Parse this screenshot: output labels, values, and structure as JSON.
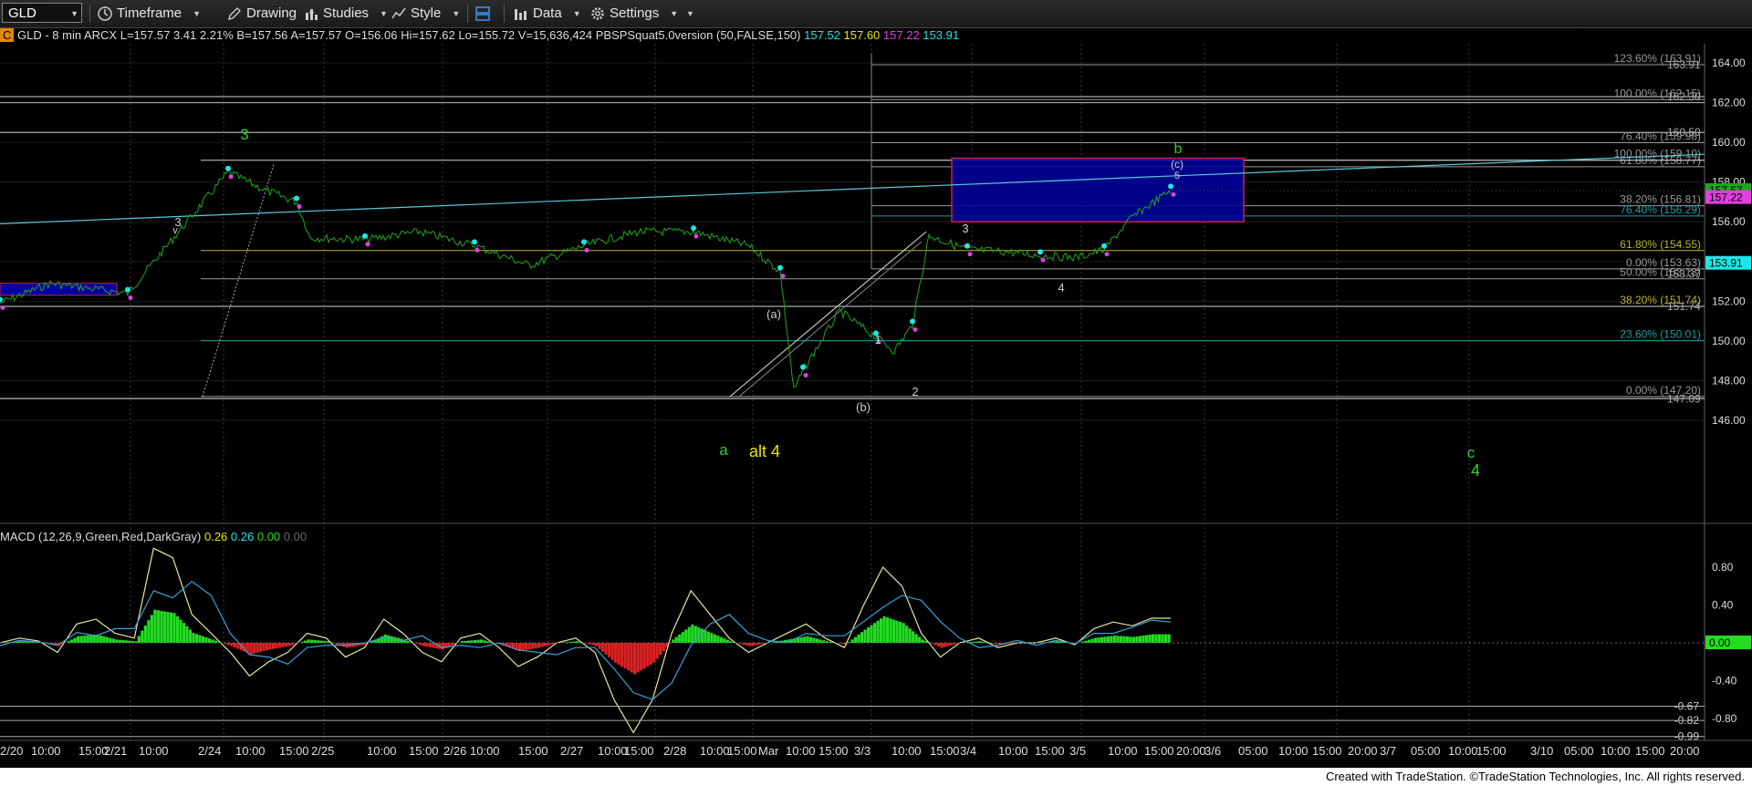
{
  "toolbar": {
    "symbol": "GLD",
    "timeframe": "Timeframe",
    "drawing": "Drawing",
    "studies": "Studies",
    "style": "Style",
    "data": "Data",
    "settings": "Settings"
  },
  "infobar": {
    "badge": "C",
    "symbol": "GLD - 8 min  ARCX",
    "last": "L=157.57",
    "change": "3.41",
    "pct": "2.21%",
    "bid": "B=157.56",
    "ask": "A=157.57",
    "open": "O=156.06",
    "high": "Hi=157.62",
    "low": "Lo=155.72",
    "volume": "V=15,636,424",
    "indicator": "PBSPSquat5.0version (50,FALSE,150)",
    "ind_v1": "157.52",
    "ind_v2": "157.60",
    "ind_v3": "157.22",
    "ind_v4": "153.91"
  },
  "macd_header": {
    "label": "MACD (12,26,9,Green,Red,DarkGray)",
    "v1": "0.26",
    "v2": "0.26",
    "v3": "0.00",
    "v4": "0.00"
  },
  "colors": {
    "price": "#1fa51f",
    "cyan": "#1ee6e6",
    "magenta": "#e040e0",
    "wave_green": "#33cc33",
    "wave_yellow": "#e6e600",
    "box_fill": "#0000a0",
    "box_border": "#cc2244",
    "macd_up": "#22dd22",
    "macd_down": "#dd2222"
  },
  "chart_data": [
    {
      "type": "line",
      "title": "GLD - 8 min ARCX",
      "ylim": [
        145,
        165
      ],
      "y_ticks": [
        "164.00",
        "162.00",
        "160.00",
        "158.00",
        "156.00",
        "154.00",
        "152.00",
        "150.00",
        "148.00",
        "146.00"
      ],
      "x_tick_labels": [
        "2/20",
        "10:00",
        "15:00",
        "2/21",
        "10:00",
        "2/24",
        "10:00",
        "15:00",
        "2/25",
        "10:00",
        "15:00",
        "2/26",
        "10:00",
        "15:00",
        "2/27",
        "10:00",
        "15:00",
        "2/28",
        "10:00",
        "15:00",
        "Mar",
        "10:00",
        "15:00",
        "3/3",
        "10:00",
        "15:00",
        "3/4",
        "10:00",
        "15:00",
        "3/5",
        "10:00",
        "15:00",
        "20:00",
        "3/6",
        "05:00",
        "10:00",
        "15:00",
        "20:00",
        "3/7",
        "05:00",
        "10:00",
        "15:00",
        "3/10",
        "05:00",
        "10:00",
        "15:00",
        "20:00"
      ],
      "series": [
        {
          "name": "GLD",
          "x": [
            "2/20",
            "2/20 10:00",
            "2/21",
            "2/21 10:00",
            "2/24",
            "2/24 10:00",
            "2/24 15:00",
            "2/25",
            "2/25 10:00",
            "2/25 15:00",
            "2/26",
            "2/26 10:00",
            "2/26 15:00",
            "2/27",
            "2/27 10:00",
            "2/27 15:00",
            "2/28",
            "2/28 10:00",
            "2/28 15:00",
            "Mar",
            "Mar 10:00",
            "Mar 15:00",
            "3/3",
            "3/3 10:00",
            "3/3 15:00",
            "3/4",
            "3/4 10:00",
            "3/4 15:00",
            "3/5",
            "3/5 10:00",
            "3/5 15:00"
          ],
          "y": [
            151.9,
            152.9,
            152.4,
            154.9,
            158.5,
            157.6,
            157.0,
            155.2,
            155.1,
            155.5,
            154.8,
            153.8,
            154.8,
            155.5,
            155.5,
            154.8,
            153.5,
            147.5,
            148.5,
            151.5,
            150.2,
            149.5,
            150.8,
            155.3,
            154.6,
            154.5,
            154.3,
            154.2,
            154.6,
            156.2,
            157.6
          ]
        }
      ],
      "price_labels": [
        {
          "text": "163.91",
          "color": "#aaaaaa"
        },
        {
          "text": "162.30",
          "color": "#aaaaaa"
        },
        {
          "text": "160.50",
          "color": "#aaaaaa"
        },
        {
          "text": "157.57",
          "color": "#1fa51f"
        },
        {
          "text": "157.22",
          "color": "#e040e0"
        },
        {
          "text": "153.91",
          "color": "#1ee6e6"
        },
        {
          "text": "153.37",
          "color": "#aaaaaa"
        },
        {
          "text": "151.74",
          "color": "#aaaaaa"
        },
        {
          "text": "147.09",
          "color": "#aaaaaa"
        }
      ],
      "fib_levels": [
        {
          "text": "123.60% (163.91)",
          "color": "#999999"
        },
        {
          "text": "100.00% (162.15)",
          "color": "#999999"
        },
        {
          "text": "76.40% (159.98)",
          "color": "#999999"
        },
        {
          "text": "100.00% (159.10)",
          "color": "#999999"
        },
        {
          "text": "61.80% (158.77)",
          "color": "#999999"
        },
        {
          "text": "38.20% (156.81)",
          "color": "#999999"
        },
        {
          "text": "76.40% (156.29)",
          "color": "#1e9e9e"
        },
        {
          "text": "61.80% (154.55)",
          "color": "#b5b52a"
        },
        {
          "text": "0.00% (153.63)",
          "color": "#999999"
        },
        {
          "text": "50.00% (153.13)",
          "color": "#999999"
        },
        {
          "text": "38.20% (151.74)",
          "color": "#b5b52a"
        },
        {
          "text": "23.60% (150.01)",
          "color": "#1e9e9e"
        },
        {
          "text": "0.00% (147.20)",
          "color": "#999999"
        }
      ],
      "wave_labels": [
        {
          "text": "3",
          "color": "#33cc33"
        },
        {
          "text": "3",
          "color": "#cccccc"
        },
        {
          "text": "v",
          "color": "#cccccc"
        },
        {
          "text": "a",
          "color": "#33cc33"
        },
        {
          "text": "alt 4",
          "color": "#e6e600"
        },
        {
          "text": "(a)",
          "color": "#cccccc"
        },
        {
          "text": "(b)",
          "color": "#cccccc"
        },
        {
          "text": "1",
          "color": "#cccccc"
        },
        {
          "text": "2",
          "color": "#cccccc"
        },
        {
          "text": "3",
          "color": "#cccccc"
        },
        {
          "text": "4",
          "color": "#cccccc"
        },
        {
          "text": "b",
          "color": "#33cc33"
        },
        {
          "text": "(c)",
          "color": "#cccccc"
        },
        {
          "text": "5",
          "color": "#cccccc"
        },
        {
          "text": "c",
          "color": "#33cc33"
        },
        {
          "text": "4",
          "color": "#33cc33"
        }
      ]
    },
    {
      "type": "line",
      "title": "MACD (12,26,9,Green,Red,DarkGray)",
      "ylim": [
        -1.0,
        1.0
      ],
      "y_ticks": [
        "0.80",
        "0.40",
        "0.00",
        "-0.40",
        "-0.80"
      ],
      "price_labels": [
        {
          "text": "0.00",
          "color": "#22dd22"
        },
        {
          "text": "-0.67",
          "color": "#cccccc"
        },
        {
          "text": "-0.82",
          "color": "#cccccc"
        },
        {
          "text": "-0.99",
          "color": "#cccccc"
        }
      ],
      "series": [
        {
          "name": "MACD",
          "y": [
            0.0,
            0.05,
            0.02,
            -0.1,
            0.2,
            0.25,
            0.1,
            0.05,
            1.0,
            0.9,
            0.3,
            0.1,
            -0.1,
            -0.35,
            -0.2,
            -0.1,
            0.1,
            0.05,
            -0.15,
            -0.05,
            0.25,
            0.1,
            -0.1,
            -0.2,
            0.05,
            0.1,
            -0.05,
            -0.25,
            -0.15,
            0.0,
            0.05,
            -0.1,
            -0.6,
            -0.95,
            -0.6,
            0.1,
            0.55,
            0.3,
            0.05,
            -0.1,
            0.0,
            0.1,
            0.2,
            0.05,
            -0.05,
            0.4,
            0.8,
            0.6,
            0.1,
            -0.15,
            0.0,
            0.05,
            -0.05,
            0.0,
            0.0,
            0.05,
            -0.02,
            0.15,
            0.22,
            0.18,
            0.26,
            0.26
          ]
        }
      ]
    }
  ],
  "footer": {
    "text": "Created with TradeStation. ©TradeStation Technologies, Inc. All rights reserved."
  }
}
